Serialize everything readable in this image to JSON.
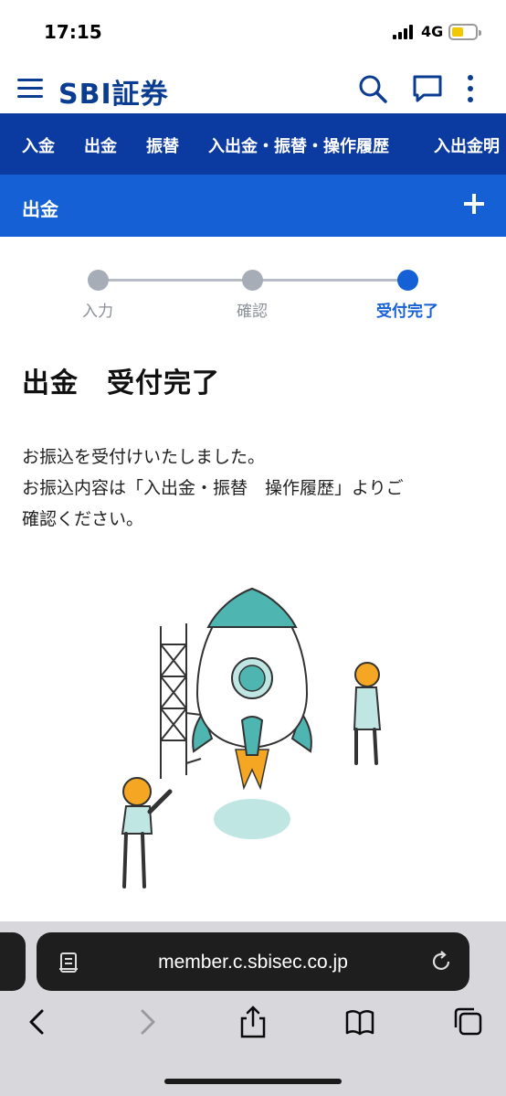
{
  "status_bar": {
    "time": "17:15",
    "network": "4G"
  },
  "header": {
    "brand": "SBI証券"
  },
  "top_nav": {
    "items": [
      "入金",
      "出金",
      "振替",
      "入出金・振替・操作履歴",
      "入出金明"
    ]
  },
  "section": {
    "title": "出金"
  },
  "stepper": {
    "steps": [
      {
        "label": "入力",
        "state": "done"
      },
      {
        "label": "確認",
        "state": "done"
      },
      {
        "label": "受付完了",
        "state": "current"
      }
    ]
  },
  "content": {
    "heading": "出金　受付完了",
    "message_lines": [
      "お振込を受付けいたしました。",
      "お振込内容は「入出金・振替　操作履歴」よりご",
      "確認ください。"
    ]
  },
  "browser": {
    "url": "member.c.sbisec.co.jp"
  },
  "colors": {
    "brand_navy": "#0a3d91",
    "nav_bg": "#0b3aa0",
    "section_bg": "#1660d6",
    "step_active": "#1660d6",
    "step_inactive": "#a7adb7",
    "rocket_teal": "#4fb5b0"
  },
  "icons": [
    "menu-icon",
    "search-icon",
    "chat-icon",
    "more-vertical-icon",
    "plus-icon",
    "document-icon",
    "reload-icon",
    "back-icon",
    "forward-icon",
    "share-icon",
    "bookmarks-icon",
    "tabs-icon"
  ]
}
